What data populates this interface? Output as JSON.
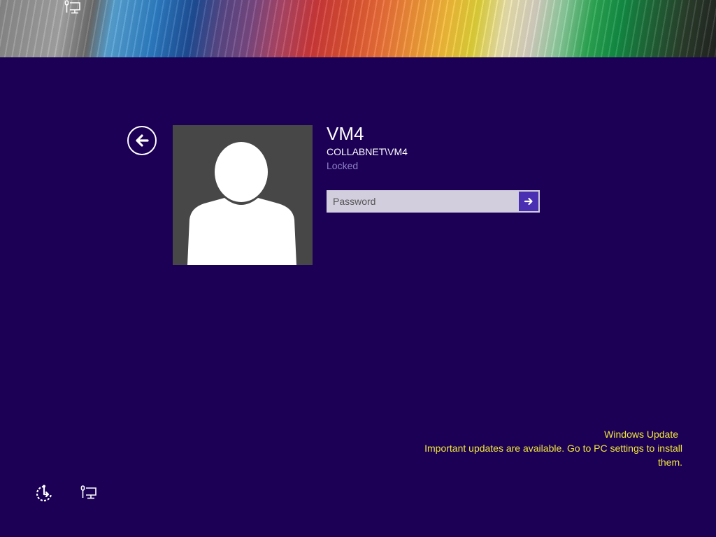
{
  "user": {
    "name": "VM4",
    "domain": "COLLABNET\\VM4",
    "status": "Locked"
  },
  "password": {
    "placeholder": "Password",
    "value": ""
  },
  "notification": {
    "title": "Windows Update",
    "message": "Important updates are available. Go to PC settings to install them."
  },
  "icons": {
    "top_network": "network-icon",
    "back": "back-arrow-icon",
    "submit": "right-arrow-icon",
    "ease_of_access": "ease-of-access-icon",
    "bottom_network": "network-icon"
  },
  "colors": {
    "background": "#1b0055",
    "avatar_bg": "#474747",
    "status_text": "#8f83c7",
    "submit_button": "#4b2fb2",
    "notification_text": "#f2e83a"
  }
}
